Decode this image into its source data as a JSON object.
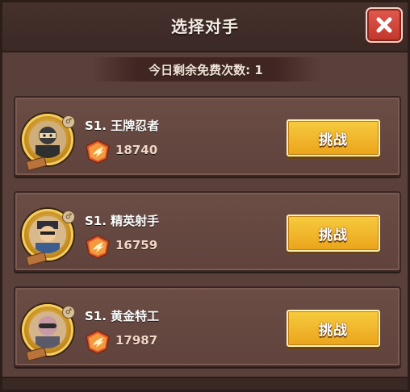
{
  "dialog": {
    "title": "选择对手",
    "remaining_free": "今日剩余免费次数: 1"
  },
  "opponents": [
    {
      "name": "S1. 王牌忍者",
      "power": "18740",
      "button": "挑战"
    },
    {
      "name": "S1. 精英射手",
      "power": "16759",
      "button": "挑战"
    },
    {
      "name": "S1. 黄金特工",
      "power": "17987",
      "button": "挑战"
    }
  ],
  "icons": {
    "close": "close-icon",
    "power": "power-emblem-icon",
    "avatar_badge": "gender-badge-icon"
  },
  "colors": {
    "accent_button": "#eaa41b",
    "close_button": "#c2362b",
    "panel": "#5a403a"
  }
}
